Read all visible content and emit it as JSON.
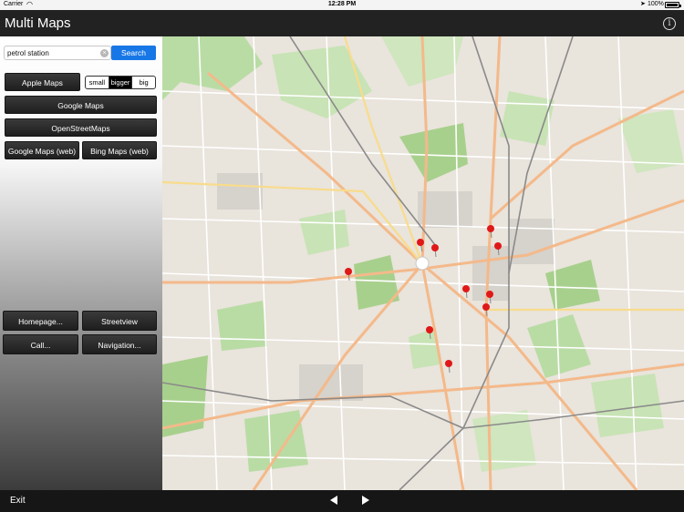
{
  "status_bar": {
    "carrier": "Carrier",
    "time": "12:28 PM",
    "battery": "100%",
    "icons": [
      "wifi-icon",
      "location-arrow-icon",
      "battery-icon"
    ]
  },
  "nav_bar": {
    "title": "Multi Maps",
    "info_icon": "info-icon",
    "info_glyph": "i"
  },
  "search": {
    "value": "petrol station",
    "button_label": "Search",
    "clear_glyph": "×"
  },
  "map_buttons": {
    "apple": "Apple Maps",
    "google": "Google Maps",
    "osm": "OpenStreetMaps",
    "google_web": "Google Maps (web)",
    "bing_web": "Bing Maps (web)"
  },
  "size_segment": {
    "options": [
      "small",
      "bigger",
      "big"
    ],
    "selected": "bigger"
  },
  "actions": {
    "homepage": "Homepage...",
    "streetview": "Streetview",
    "call": "Call...",
    "navigation": "Navigation..."
  },
  "bottom_bar": {
    "exit_label": "Exit",
    "prev_icon": "triangle-left-icon",
    "next_icon": "triangle-right-icon"
  },
  "map": {
    "current_location_icon": "current-location-icon",
    "pin_icon": "red-pin-icon",
    "colors": {
      "background": "#e9e4dc",
      "park": "#b9dca5",
      "forest": "#a8d08d",
      "road_major": "#f4b98a",
      "road_minor": "#ffffff",
      "rail": "#8a8a8a",
      "pin": "#e01818"
    }
  }
}
